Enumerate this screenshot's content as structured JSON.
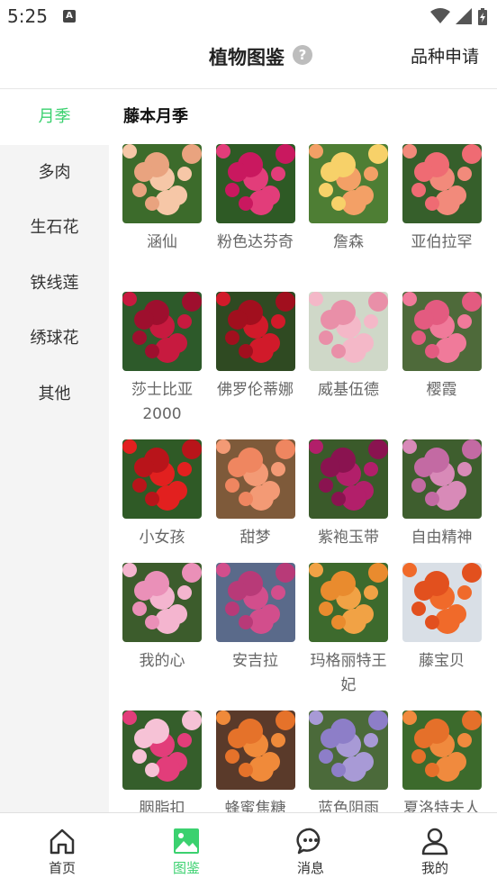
{
  "status_bar": {
    "time": "5:25",
    "notification_icon": "A"
  },
  "header": {
    "title": "植物图鉴",
    "help_icon": "?",
    "apply_label": "品种申请"
  },
  "sidebar": {
    "items": [
      {
        "label": "月季",
        "active": true
      },
      {
        "label": "多肉",
        "active": false
      },
      {
        "label": "生石花",
        "active": false
      },
      {
        "label": "铁线莲",
        "active": false
      },
      {
        "label": "绣球花",
        "active": false
      },
      {
        "label": "其他",
        "active": false
      }
    ]
  },
  "content": {
    "section_title": "藤本月季",
    "varieties": [
      {
        "name": "涵仙",
        "colors": [
          "#f6c7a7",
          "#e9a37f",
          "#3c6b2b"
        ]
      },
      {
        "name": "粉色达芬奇",
        "colors": [
          "#e23d7a",
          "#c9185f",
          "#2e5a25"
        ]
      },
      {
        "name": "詹森",
        "colors": [
          "#f3a066",
          "#f7d169",
          "#4e7e34"
        ]
      },
      {
        "name": "亚伯拉罕",
        "colors": [
          "#f28a7b",
          "#ef6b73",
          "#365f2b"
        ]
      },
      {
        "name": "莎士比亚2000",
        "colors": [
          "#c71a3f",
          "#9e0f2e",
          "#2d5a2a"
        ]
      },
      {
        "name": "佛罗伦蒂娜",
        "colors": [
          "#d11a2a",
          "#a10f1e",
          "#2f4a22"
        ]
      },
      {
        "name": "威基伍德",
        "colors": [
          "#f4b8c8",
          "#e98fa8",
          "#cfd8c8"
        ]
      },
      {
        "name": "樱霞",
        "colors": [
          "#f07a9a",
          "#e35b80",
          "#4e6a3a"
        ]
      },
      {
        "name": "小女孩",
        "colors": [
          "#e2201f",
          "#b8141a",
          "#2f5a26"
        ]
      },
      {
        "name": "甜梦",
        "colors": [
          "#f39a75",
          "#ef8660",
          "#7e5a3a"
        ]
      },
      {
        "name": "紫袍玉带",
        "colors": [
          "#b21f6a",
          "#8a1350",
          "#3a5a2a"
        ]
      },
      {
        "name": "自由精神",
        "colors": [
          "#d88ab8",
          "#c36aa3",
          "#3e5e2e"
        ]
      },
      {
        "name": "我的心",
        "colors": [
          "#f4b5cf",
          "#ea90b8",
          "#3c5c2c"
        ]
      },
      {
        "name": "安吉拉",
        "colors": [
          "#d24e8c",
          "#b83a78",
          "#5a6a8a"
        ]
      },
      {
        "name": "玛格丽特王妃",
        "colors": [
          "#f1a245",
          "#e98b2e",
          "#3d6a2d"
        ]
      },
      {
        "name": "藤宝贝",
        "colors": [
          "#f06a2a",
          "#e2501e",
          "#d9dfe6"
        ]
      },
      {
        "name": "胭脂扣",
        "colors": [
          "#e23d7a",
          "#f6c2d6",
          "#355e2b"
        ]
      },
      {
        "name": "蜂蜜焦糖",
        "colors": [
          "#f08a3a",
          "#e5722a",
          "#5a3a2a"
        ]
      },
      {
        "name": "蓝色阴雨",
        "colors": [
          "#a89ad6",
          "#8d7ec8",
          "#4b6a3a"
        ]
      },
      {
        "name": "夏洛特夫人",
        "colors": [
          "#f08a3e",
          "#e5702a",
          "#3c6a2c"
        ]
      }
    ]
  },
  "bottom_nav": {
    "items": [
      {
        "label": "首页",
        "icon": "home-icon",
        "active": false
      },
      {
        "label": "图鉴",
        "icon": "gallery-icon",
        "active": true
      },
      {
        "label": "消息",
        "icon": "chat-icon",
        "active": false
      },
      {
        "label": "我的",
        "icon": "user-icon",
        "active": false
      }
    ]
  },
  "colors": {
    "accent": "#3bd16f",
    "sidebar_bg": "#f4f4f4",
    "text_secondary": "#666666"
  }
}
